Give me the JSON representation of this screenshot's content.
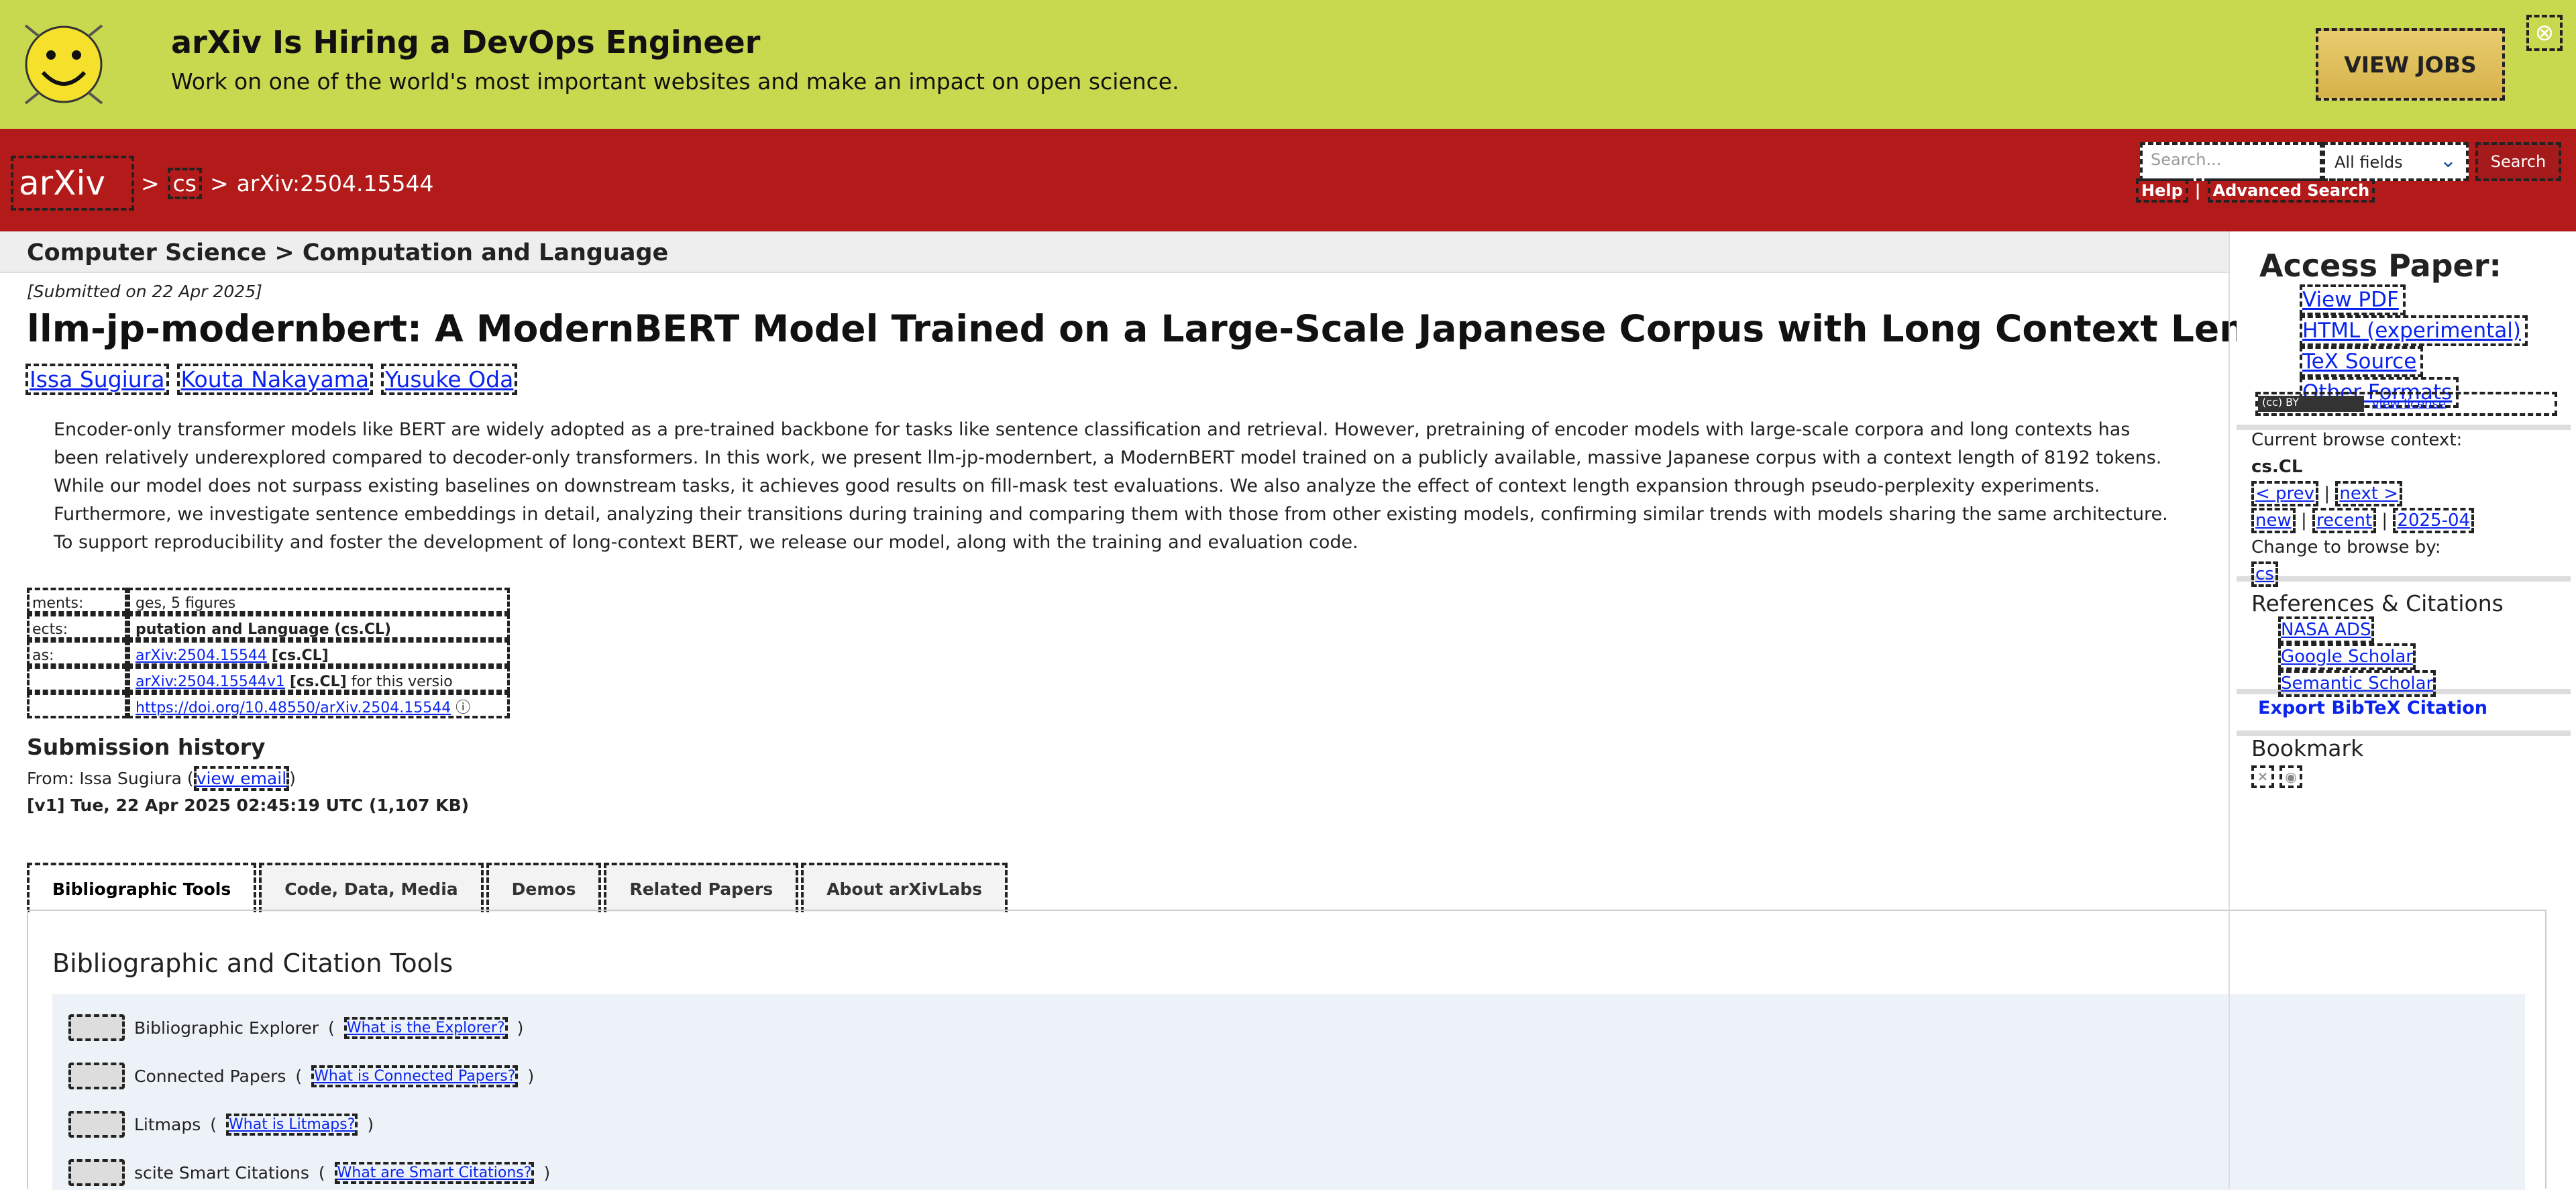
{
  "banner": {
    "title": "arXiv Is Hiring a DevOps Engineer",
    "subtitle": "Work on one of the world's most important websites and make an impact on open science.",
    "jobs_button": "VIEW JOBS",
    "close_glyph": "⊗"
  },
  "header": {
    "logo_text": "arXiv",
    "crumb_sep": ">",
    "crumb_cs": "cs",
    "crumb_id": "arXiv:2504.15544",
    "search_placeholder": "Search...",
    "field_selected": "All fields",
    "search_button": "Search",
    "help": "Help",
    "pipe": "|",
    "advanced": "Advanced Search"
  },
  "subheader": "Computer Science > Computation and Language",
  "paper": {
    "submitted": "[Submitted on 22 Apr 2025]",
    "title": "llm-jp-modernbert: A ModernBERT Model Trained on a Large-Scale Japanese Corpus with Long Context Length",
    "authors": [
      "Issa Sugiura",
      "Kouta Nakayama",
      "Yusuke Oda"
    ],
    "abstract": "Encoder-only transformer models like BERT are widely adopted as a pre-trained backbone for tasks like sentence classification and retrieval. However, pretraining of encoder models with large-scale corpora and long contexts has been relatively underexplored compared to decoder-only transformers. In this work, we present llm-jp-modernbert, a ModernBERT model trained on a publicly available, massive Japanese corpus with a context length of 8192 tokens. While our model does not surpass existing baselines on downstream tasks, it achieves good results on fill-mask test evaluations. We also analyze the effect of context length expansion through pseudo-perplexity experiments. Furthermore, we investigate sentence embeddings in detail, analyzing their transitions during training and comparing them with those from other existing models, confirming similar trends with models sharing the same architecture. To support reproducibility and foster the development of long-context BERT, we release our model, along with the training and evaluation code."
  },
  "meta": {
    "comments_label": "ments:",
    "comments_value": "ges, 5 figures",
    "subjects_label": "ects:",
    "subjects_value": "putation and Language (cs.CL)",
    "cite_label": "as:",
    "cite_link": "arXiv:2504.15544",
    "cite_tag": "[cs.CL]",
    "v1_link": "arXiv:2504.15544v1",
    "v1_tag": "[cs.CL]",
    "v1_suffix": "for this versio",
    "doi": "https://doi.org/10.48550/arXiv.2504.15544"
  },
  "history": {
    "heading": "Submission history",
    "from": "From: Issa Sugiura",
    "view_email": "view email",
    "v1": "[v1] Tue, 22 Apr 2025 02:45:19 UTC (1,107 KB)"
  },
  "tabs": [
    "Bibliographic Tools",
    "Code, Data, Media",
    "Demos",
    "Related Papers",
    "About arXivLabs"
  ],
  "tools_panel": {
    "heading": "Bibliographic and Citation Tools",
    "items": [
      {
        "label": "Bibliographic Explorer",
        "link": "What is the Explorer?"
      },
      {
        "label": "Connected Papers",
        "link": "What is Connected Papers?"
      },
      {
        "label": "Litmaps",
        "link": "What is Litmaps?"
      },
      {
        "label": "scite Smart Citations",
        "link": "What are Smart Citations?"
      }
    ]
  },
  "sidebar": {
    "access_title": "Access Paper:",
    "access_links": [
      "View PDF",
      "HTML (experimental)",
      "TeX Source",
      "Other Formats"
    ],
    "license_badge": "(cc) BY",
    "view_license": "view license",
    "context_label": "Current browse context:",
    "context_value": "cs.CL",
    "prev": "< prev",
    "next": "next >",
    "new": "new",
    "recent": "recent",
    "month": "2025-04",
    "change_label": "Change to browse by:",
    "change_cs": "cs",
    "refs_heading": "References & Citations",
    "refs_links": [
      "NASA ADS",
      "Google Scholar",
      "Semantic Scholar"
    ],
    "bibtex": "Export BibTeX Citation",
    "bookmark": "Bookmark"
  }
}
